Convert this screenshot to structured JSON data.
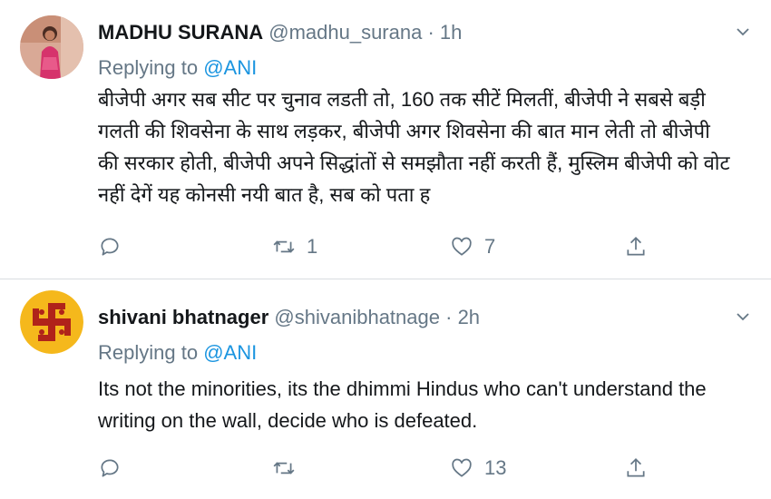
{
  "tweets": [
    {
      "display_name": "MADHU SURANA",
      "handle": "@madhu_surana",
      "separator": "·",
      "time": "1h",
      "replying_prefix": "Replying to",
      "replying_to": "@ANI",
      "text": "बीजेपी अगर सब सीट पर चुनाव लडती तो, 160 तक सीटें मिलतीं, बीजेपी ने सबसे बड़ी गलती की शिवसेना के साथ लड़कर, बीजेपी अगर शिवसेना की बात मान लेती तो बीजेपी की सरकार होती, बीजेपी अपने सिद्धांतों से समझौता नहीं करती हैं, मुस्लिम बीजेपी को वोट नहीं देगें यह कोनसी नयी बात है, सब को पता ह",
      "retweets": "1",
      "likes": "7",
      "avatar_icon": "woman-photo-avatar"
    },
    {
      "display_name": "shivani bhatnager",
      "handle": "@shivanibhatnage",
      "separator": "·",
      "time": "2h",
      "replying_prefix": "Replying to",
      "replying_to": "@ANI",
      "text": "Its not the minorities, its the dhimmi Hindus who can't understand the writing on the wall, decide who is defeated.",
      "retweets": "",
      "likes": "13",
      "avatar_icon": "swastika-symbol-avatar"
    }
  ],
  "icons": {
    "reply": "reply-icon",
    "retweet": "retweet-icon",
    "like": "heart-icon",
    "share": "share-icon",
    "caret": "chevron-down-icon"
  },
  "colors": {
    "link": "#1b95e0",
    "muted": "#657786",
    "text": "#14171a",
    "swastika_red": "#b0231a",
    "swastika_bg": "#f5b81c"
  }
}
